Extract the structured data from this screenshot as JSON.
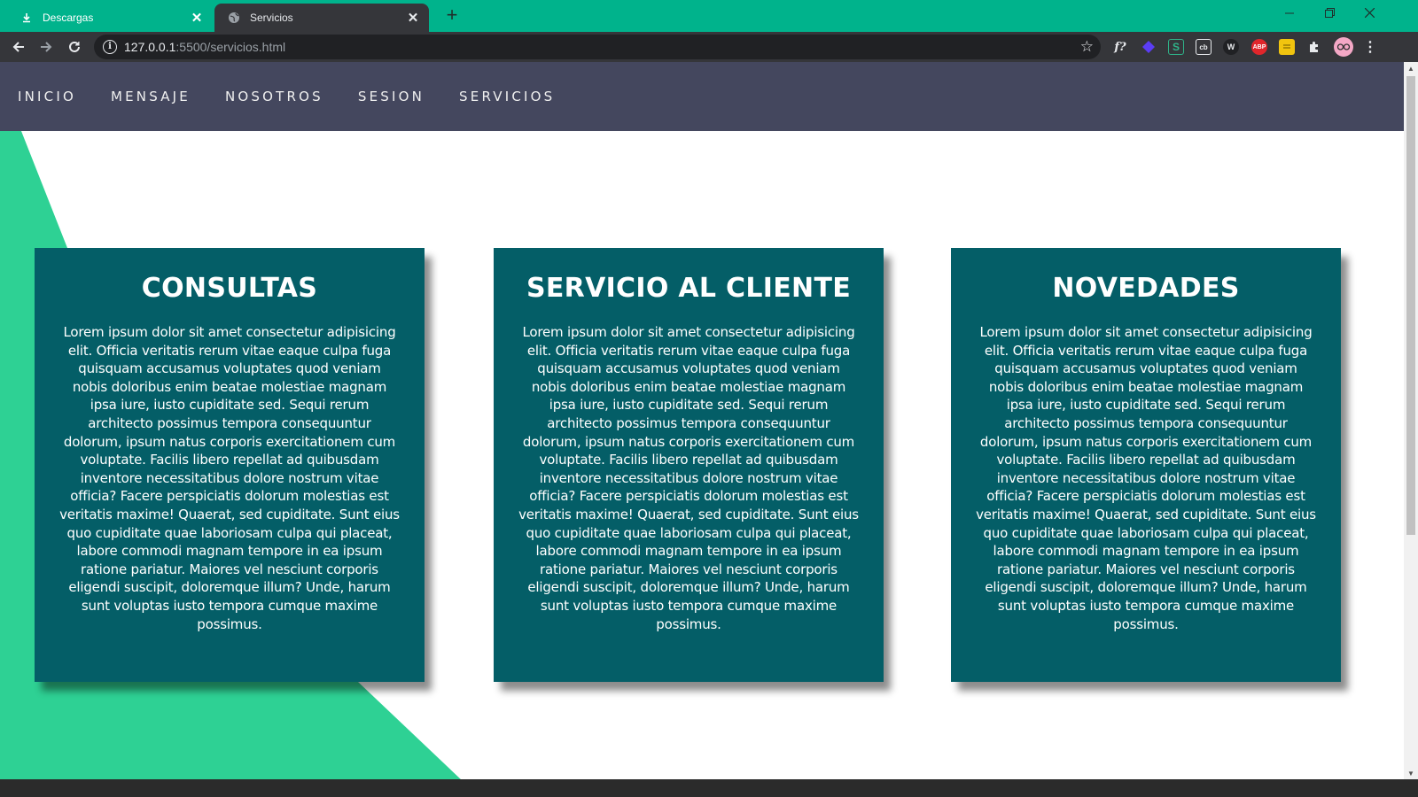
{
  "browser": {
    "tabs": [
      {
        "title": "Descargas",
        "icon": "download-icon",
        "active": false
      },
      {
        "title": "Servicios",
        "icon": "globe-icon",
        "active": true
      }
    ],
    "url_host": "127.0.0.1",
    "url_path": ":5500/servicios.html",
    "extensions": [
      "formula-icon",
      "gem-icon",
      "s-icon",
      "cb-icon",
      "w-icon",
      "abp-icon",
      "note-icon",
      "puzzle-icon",
      "avatar"
    ],
    "extension_labels": {
      "formula": "f?",
      "s": "S",
      "cb": "cb",
      "w": "W",
      "abp": "ABP"
    }
  },
  "nav": {
    "items": [
      "INICIO",
      "MENSAJE",
      "NOSOTROS",
      "SESION",
      "SERVICIOS"
    ]
  },
  "cards": [
    {
      "title": "CONSULTAS",
      "body": "Lorem ipsum dolor sit amet consectetur adipisicing elit. Officia veritatis rerum vitae eaque culpa fuga quisquam accusamus voluptates quod veniam nobis doloribus enim beatae molestiae magnam ipsa iure, iusto cupiditate sed. Sequi rerum architecto possimus tempora consequuntur dolorum, ipsum natus corporis exercitationem cum voluptate. Facilis libero repellat ad quibusdam inventore necessitatibus dolore nostrum vitae officia? Facere perspiciatis dolorum molestias est veritatis maxime! Quaerat, sed cupiditate. Sunt eius quo cupiditate quae laboriosam culpa qui placeat, labore commodi magnam tempore in ea ipsum ratione pariatur. Maiores vel nesciunt corporis eligendi suscipit, doloremque illum? Unde, harum sunt voluptas iusto tempora cumque maxime possimus."
    },
    {
      "title": "SERVICIO AL CLIENTE",
      "body": "Lorem ipsum dolor sit amet consectetur adipisicing elit. Officia veritatis rerum vitae eaque culpa fuga quisquam accusamus voluptates quod veniam nobis doloribus enim beatae molestiae magnam ipsa iure, iusto cupiditate sed. Sequi rerum architecto possimus tempora consequuntur dolorum, ipsum natus corporis exercitationem cum voluptate. Facilis libero repellat ad quibusdam inventore necessitatibus dolore nostrum vitae officia? Facere perspiciatis dolorum molestias est veritatis maxime! Quaerat, sed cupiditate. Sunt eius quo cupiditate quae laboriosam culpa qui placeat, labore commodi magnam tempore in ea ipsum ratione pariatur. Maiores vel nesciunt corporis eligendi suscipit, doloremque illum? Unde, harum sunt voluptas iusto tempora cumque maxime possimus."
    },
    {
      "title": "NOVEDADES",
      "body": "Lorem ipsum dolor sit amet consectetur adipisicing elit. Officia veritatis rerum vitae eaque culpa fuga quisquam accusamus voluptates quod veniam nobis doloribus enim beatae molestiae magnam ipsa iure, iusto cupiditate sed. Sequi rerum architecto possimus tempora consequuntur dolorum, ipsum natus corporis exercitationem cum voluptate. Facilis libero repellat ad quibusdam inventore necessitatibus dolore nostrum vitae officia? Facere perspiciatis dolorum molestias est veritatis maxime! Quaerat, sed cupiditate. Sunt eius quo cupiditate quae laboriosam culpa qui placeat, labore commodi magnam tempore in ea ipsum ratione pariatur. Maiores vel nesciunt corporis eligendi suscipit, doloremque illum? Unde, harum sunt voluptas iusto tempora cumque maxime possimus."
    }
  ],
  "colors": {
    "tabstrip": "#00b38c",
    "nav_bg": "#44475e",
    "card_bg": "#045e67",
    "accent_shape": "#2ed194"
  }
}
